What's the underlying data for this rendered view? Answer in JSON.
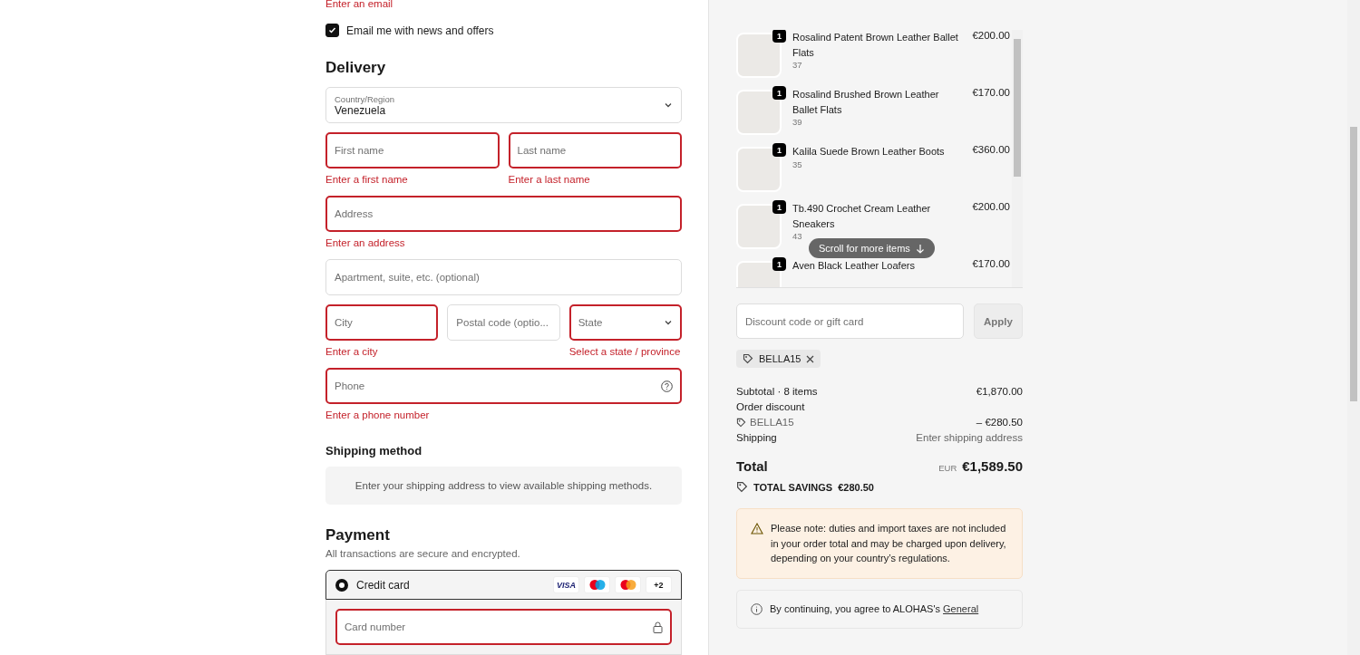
{
  "contact": {
    "email_error": "Enter an email",
    "newsletter": {
      "label": "Email me with news and offers",
      "checked": true
    }
  },
  "delivery": {
    "title": "Delivery",
    "rows": [
      {
        "fields": [
          {
            "kind": "select",
            "label": "Country/Region",
            "value": "Venezuela",
            "invalid": false
          }
        ]
      },
      {
        "fields": [
          {
            "kind": "input",
            "placeholder": "First name",
            "invalid": true,
            "error": "Enter a first name"
          },
          {
            "kind": "input",
            "placeholder": "Last name",
            "invalid": true,
            "error": "Enter a last name"
          }
        ]
      },
      {
        "fields": [
          {
            "kind": "input",
            "placeholder": "Address",
            "invalid": true,
            "error": "Enter an address"
          }
        ]
      },
      {
        "fields": [
          {
            "kind": "input",
            "placeholder": "Apartment, suite, etc. (optional)",
            "invalid": false
          }
        ]
      },
      {
        "fields": [
          {
            "kind": "input",
            "placeholder": "City",
            "invalid": true,
            "error": "Enter a city"
          },
          {
            "kind": "input",
            "placeholder": "Postal code (optio...",
            "invalid": false
          },
          {
            "kind": "select",
            "placeholder": "State",
            "invalid": true,
            "error": "Select a state / province"
          }
        ]
      },
      {
        "fields": [
          {
            "kind": "help",
            "placeholder": "Phone",
            "invalid": true,
            "error": "Enter a phone number"
          }
        ]
      }
    ]
  },
  "shipping": {
    "title": "Shipping method",
    "message": "Enter your shipping address to view available shipping methods."
  },
  "payment": {
    "title": "Payment",
    "subtitle": "All transactions are secure and encrypted.",
    "methods": [
      {
        "label": "Credit card",
        "selected": true,
        "cards": [
          {
            "kind": "visa",
            "label": "VISA"
          },
          {
            "kind": "maestro"
          },
          {
            "kind": "mastercard"
          },
          {
            "kind": "more",
            "label": "+2"
          }
        ]
      }
    ],
    "card_number": {
      "placeholder": "Card number",
      "invalid": true
    }
  },
  "cart": {
    "items": [
      {
        "name": "Rosalind Patent Brown Leather Ballet Flats",
        "size": "37",
        "price": "€200.00",
        "quantity": "1"
      },
      {
        "name": "Rosalind Brushed Brown Leather Ballet Flats",
        "size": "39",
        "price": "€170.00",
        "quantity": "1"
      },
      {
        "name": "Kalila Suede Brown Leather Boots",
        "size": "35",
        "price": "€360.00",
        "quantity": "1"
      },
      {
        "name": "Tb.490 Crochet Cream Leather Sneakers",
        "size": "43",
        "price": "€200.00",
        "quantity": "1"
      },
      {
        "name": "Aven Black Leather Loafers",
        "price": "€170.00",
        "quantity": "1"
      }
    ],
    "scroll_hint": "Scroll for more items"
  },
  "discount": {
    "placeholder": "Discount code or gift card",
    "button": "Apply",
    "applied": [
      {
        "code": "BELLA15"
      }
    ]
  },
  "summary": {
    "subtotal": {
      "label": "Subtotal · 8 items",
      "value": "€1,870.00"
    },
    "discount": {
      "label": "Order discount",
      "code": "BELLA15",
      "value": "– €280.50"
    },
    "shipping": {
      "label": "Shipping",
      "value": "Enter shipping address"
    },
    "total": {
      "label": "Total",
      "currency": "EUR",
      "value": "€1,589.50"
    },
    "savings": {
      "label": "TOTAL SAVINGS",
      "value": "€280.50"
    }
  },
  "notice": "Please note: duties and import taxes are not included in your order total and may be charged upon delivery, depending on your country’s regulations.",
  "terms": {
    "text": "By continuing, you agree to ALOHAS's",
    "link": "General"
  }
}
